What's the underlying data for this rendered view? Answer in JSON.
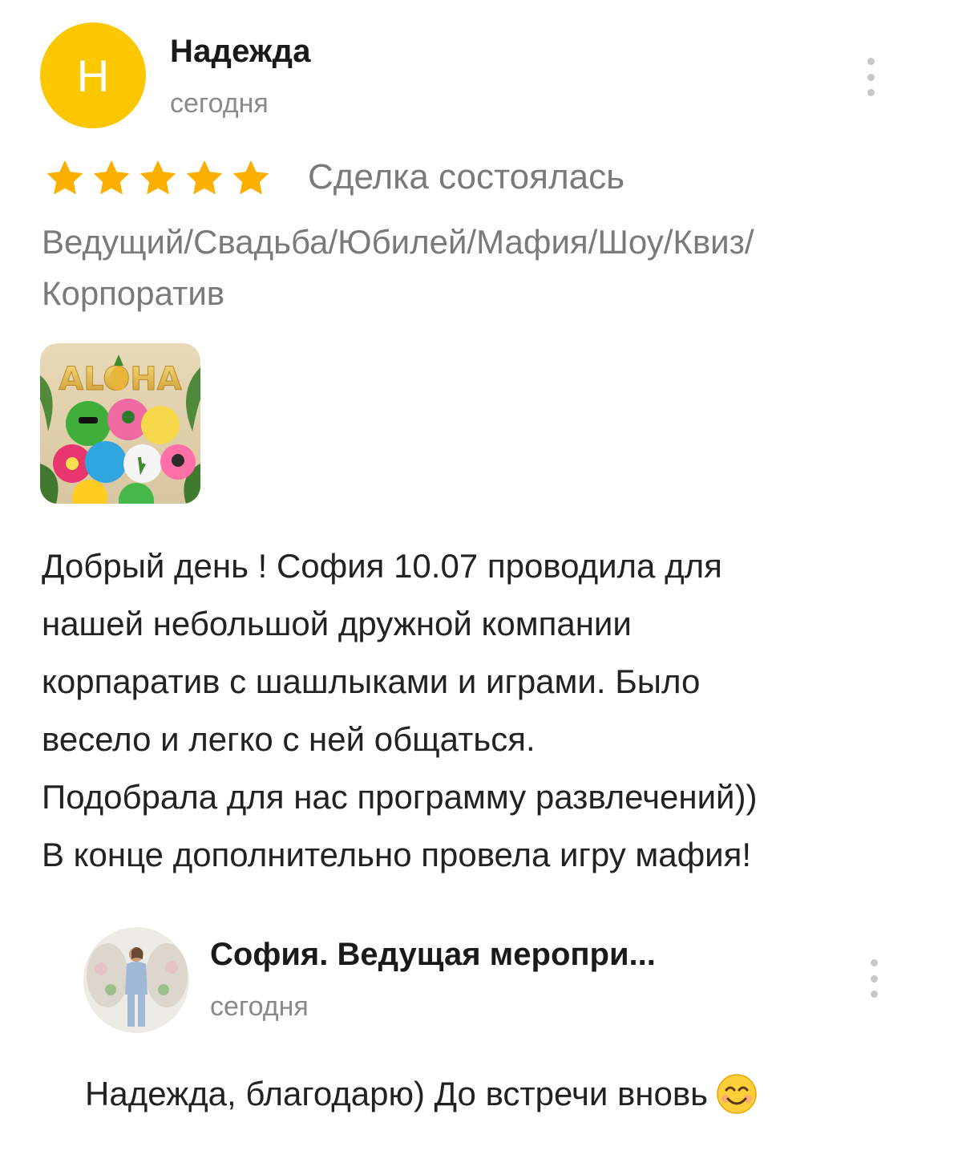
{
  "review": {
    "avatar_letter": "Н",
    "avatar_color": "#fbc700",
    "author": "Надежда",
    "date": "сегодня",
    "rating": 5,
    "rating_max": 5,
    "star_color": "#fbb000",
    "deal_status": "Сделка состоялась",
    "category": "Ведущий/Свадьба/Юбилей/Мафия/Шоу/Квиз/\nКорпоратив",
    "photo_text": "ALOHA",
    "text": "Добрый день ! София 10.07 проводила для\nнашей небольшой дружной компании\nкорпаратив с шашлыками и играми. Было\nвесело и легко с ней общаться.\nПодобрала для нас программу развлечений))\nВ конце дополнительно провела игру мафия!"
  },
  "reply": {
    "author": "София. Ведущая меропри...",
    "date": "сегодня",
    "text": "Надежда, благодарю) До встречи вновь",
    "emoji": "smiling-face-icon"
  },
  "icons": {
    "menu": "kebab-menu-icon",
    "star": "star-icon"
  }
}
